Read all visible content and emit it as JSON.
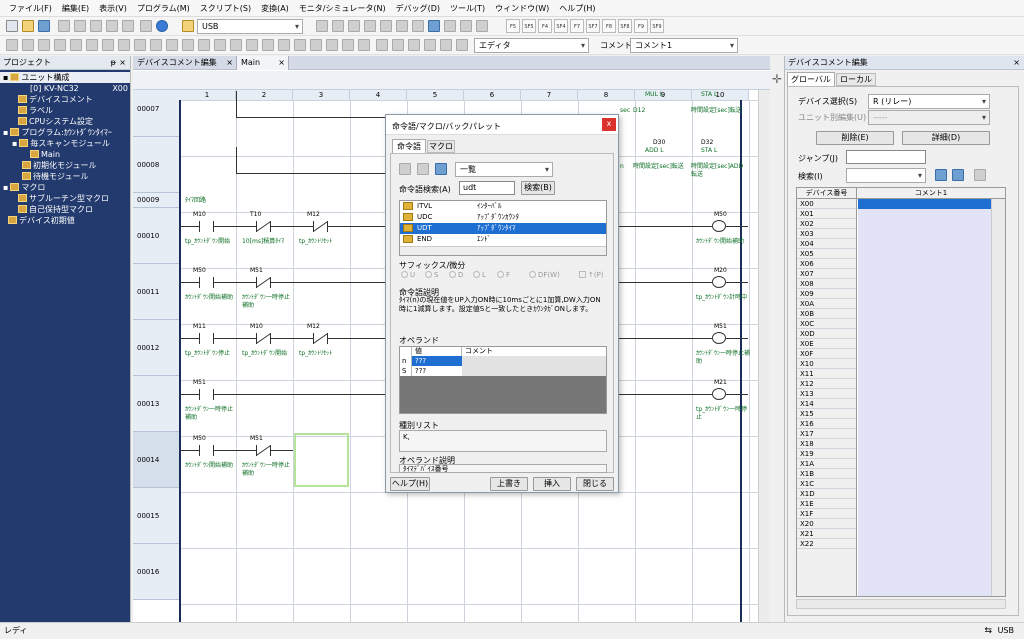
{
  "menu": [
    "ファイル(F)",
    "編集(E)",
    "表示(V)",
    "プログラム(M)",
    "スクリプト(S)",
    "変換(A)",
    "モニタ/シミュレータ(N)",
    "デバッグ(D)",
    "ツール(T)",
    "ウィンドウ(W)",
    "ヘルプ(H)"
  ],
  "toolbar": {
    "connection": "USB",
    "editor": "エディタ",
    "comment_label": "コメント",
    "comment_select": "コメント1",
    "fkeys": [
      "F5",
      "SF5",
      "F4",
      "SF4",
      "F7",
      "SF7",
      "F8",
      "SF8",
      "F9",
      "SF9"
    ]
  },
  "project": {
    "title": "プロジェクト",
    "pin": "ᵽ",
    "close": "×",
    "items": [
      "ユニット構成",
      "[0] KV-NC32",
      "X00",
      "デバイスコメント",
      "ラベル",
      "CPUシステム設定",
      "プログラム:ｶｳﾝﾄﾀﾞｳﾝﾀｲﾏｰ",
      "毎スキャンモジュール",
      "Main",
      "初期化モジュール",
      "待機モジュール",
      "マクロ",
      "サブルーチン型マクロ",
      "自己保持型マクロ",
      "デバイス初期値"
    ]
  },
  "tabs": {
    "doc1": "デバイスコメント編集",
    "doc1_close": "×",
    "doc2": "Main",
    "doc2_close": "×"
  },
  "ladder": {
    "cols": [
      "1",
      "2",
      "3",
      "4",
      "5",
      "6",
      "7",
      "8",
      "9",
      "10"
    ],
    "rows": [
      "00007",
      "00008",
      "00009",
      "00010",
      "00011",
      "00012",
      "00013",
      "00014",
      "00015",
      "00016"
    ],
    "r9_label": "ﾀｲﾏ回路",
    "r7": {
      "d1": "+100",
      "d1b": "MUL L",
      "d1c": "D12",
      "d2": "D30",
      "d2b": "STA L",
      "d2c": "時間設定[sec]転送",
      "lc": "sec"
    },
    "r8": {
      "d1": "D30",
      "d1b": "ADD L",
      "d1c": "時間設定[sec]転送",
      "d2": "D32",
      "d2b": "STA L",
      "d2c": "時間設定[sec]ADD転送",
      "lc": "n"
    },
    "r10": {
      "c1": "M10",
      "c1t": "tp_ｶｳﾝﾄﾀﾞｳﾝ開始",
      "c2": "T10",
      "c2t": "10[ms]積算ﾀｲﾏ",
      "c3": "M12",
      "c3t": "tp_ｶｳﾝﾄﾘｾｯﾄ",
      "o": "M50",
      "ot": "ｶｳﾝﾄﾀﾞｳﾝ開始補助"
    },
    "r11": {
      "c1": "M50",
      "c1t": "ｶｳﾝﾄﾀﾞｳﾝ開始補助",
      "c2": "M51",
      "c2t": "ｶｳﾝﾄﾀﾞｳﾝ一時停止補助",
      "o": "M20",
      "ot": "tp_ｶｳﾝﾄﾀﾞｳﾝ計時中"
    },
    "r12": {
      "c1": "M11",
      "c1t": "tp_ｶｳﾝﾄﾀﾞｳﾝ停止",
      "c2": "M10",
      "c2t": "tp_ｶｳﾝﾄﾀﾞｳﾝ開始",
      "c3": "M12",
      "c3t": "tp_ｶｳﾝﾄﾘｾｯﾄ",
      "o": "M51",
      "ot": "ｶｳﾝﾄﾀﾞｳﾝ一時停止補助"
    },
    "r13": {
      "c1": "M51",
      "c1t": "ｶｳﾝﾄﾀﾞｳﾝ一時停止補助",
      "o": "M21",
      "ot": "tp_ｶｳﾝﾄﾀﾞｳﾝ一時停止"
    },
    "r14": {
      "c1": "M50",
      "c1t": "ｶｳﾝﾄﾀﾞｳﾝ開始補助",
      "c2": "M51",
      "c2t": "ｶｳﾝﾄﾀﾞｳﾝ一時停止補助"
    }
  },
  "dialog": {
    "title": "命令語/マクロ/バックパレット",
    "close": "x",
    "tab1": "命令語",
    "tab2": "マクロ",
    "view": "一覧",
    "search_label": "命令語検索(A)",
    "search_value": "udt",
    "search_button": "検索(B)",
    "list": [
      {
        "name": "ITVL",
        "desc": "ｲﾝﾀｰﾊﾞﾙ"
      },
      {
        "name": "UDC",
        "desc": "ｱｯﾌﾟﾀﾞｳﾝｶｳﾝﾀ"
      },
      {
        "name": "UDT",
        "desc": "ｱｯﾌﾟﾀﾞｳﾝﾀｲﾏ"
      },
      {
        "name": "END",
        "desc": "ｴﾝﾄﾞ"
      }
    ],
    "suffix_label": "サフィックス/微分",
    "suffixes": [
      "U",
      "S",
      "D",
      "L",
      "F",
      "DF(W)",
      "↑(P)"
    ],
    "desc_label": "命令語説明",
    "desc": "ﾀｲﾏ(n)の現在値をUP入力ON時に10msごとに1加算,DW入力ON時に1減算します。設定値Sと一致したときｶｳﾝﾀｶﾞONします。",
    "operand_label": "オペランド",
    "op_col1": "値",
    "op_col2": "コメント",
    "op_rows": [
      {
        "k": "n",
        "v": "???"
      },
      {
        "k": "S",
        "v": "???"
      }
    ],
    "type_label": "種別リスト",
    "type_value": "K,",
    "opdesc_label": "オペランド説明",
    "opdesc_value": "ﾀｲﾏﾃﾞﾊﾞｲｽ番号",
    "help": "ヘルプ(H)",
    "overwrite": "上書き",
    "insert": "挿入",
    "closebtn": "閉じる"
  },
  "right": {
    "title": "デバイスコメント編集",
    "close": "×",
    "tab1": "グローバル",
    "tab2": "ローカル",
    "dev_select_label": "デバイス選択(S)",
    "dev_select": "R (リレー)",
    "unit_label": "ユニット別編集(U)",
    "unit_value": "-----",
    "delete_btn": "削除(E)",
    "detail_btn": "詳細(D)",
    "jump_label": "ジャンプ(J)",
    "search_label": "検索(I)",
    "col1": "デバイス番号",
    "col2": "コメント1",
    "devices": [
      "X00",
      "X01",
      "X02",
      "X03",
      "X04",
      "X05",
      "X06",
      "X07",
      "X08",
      "X09",
      "X0A",
      "X0B",
      "X0C",
      "X0D",
      "X0E",
      "X0F",
      "X10",
      "X11",
      "X12",
      "X13",
      "X14",
      "X15",
      "X16",
      "X17",
      "X18",
      "X19",
      "X1A",
      "X1B",
      "X1C",
      "X1D",
      "X1E",
      "X1F",
      "X20",
      "X21",
      "X22"
    ]
  },
  "status": {
    "left": "レディ",
    "right": "USB"
  }
}
